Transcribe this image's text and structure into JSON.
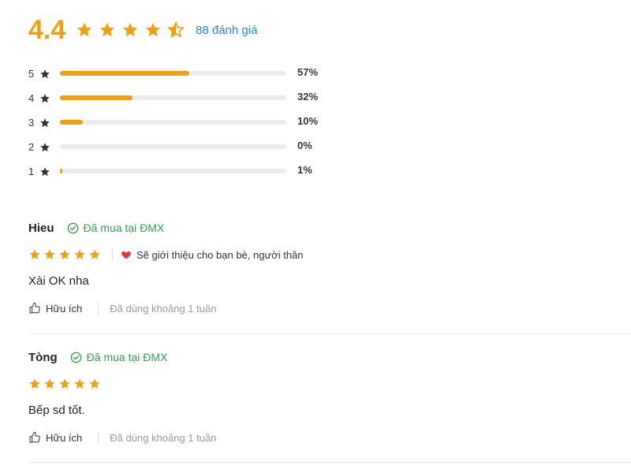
{
  "summary": {
    "average": "4.4",
    "stars": [
      1,
      1,
      1,
      1,
      0.5
    ],
    "count_label": "88 đánh giá"
  },
  "distribution": [
    {
      "label": "5",
      "percent": 57,
      "percent_label": "57%"
    },
    {
      "label": "4",
      "percent": 32,
      "percent_label": "32%"
    },
    {
      "label": "3",
      "percent": 10,
      "percent_label": "10%"
    },
    {
      "label": "2",
      "percent": 0,
      "percent_label": "0%"
    },
    {
      "label": "1",
      "percent": 1,
      "percent_label": "1%"
    }
  ],
  "reviews": [
    {
      "name": "Hieu",
      "verified": "Đã mua tại ĐMX",
      "rating": 5,
      "recommend": "Sẽ giới thiệu cho bạn bè, người thân",
      "content": "Xài OK nha",
      "helpful": "Hữu ích",
      "used": "Đã dùng khoảng 1 tuần"
    },
    {
      "name": "Tòng",
      "verified": "Đã mua tại ĐMX",
      "rating": 5,
      "recommend": "",
      "content": "Bếp sd tốt.",
      "helpful": "Hữu ích",
      "used": "Đã dùng khoảng 1 tuần"
    }
  ],
  "colors": {
    "star": "#f59e0b",
    "link": "#2f80ed",
    "verified": "#2ba24c",
    "heart": "#e53935",
    "track": "#ececec"
  }
}
